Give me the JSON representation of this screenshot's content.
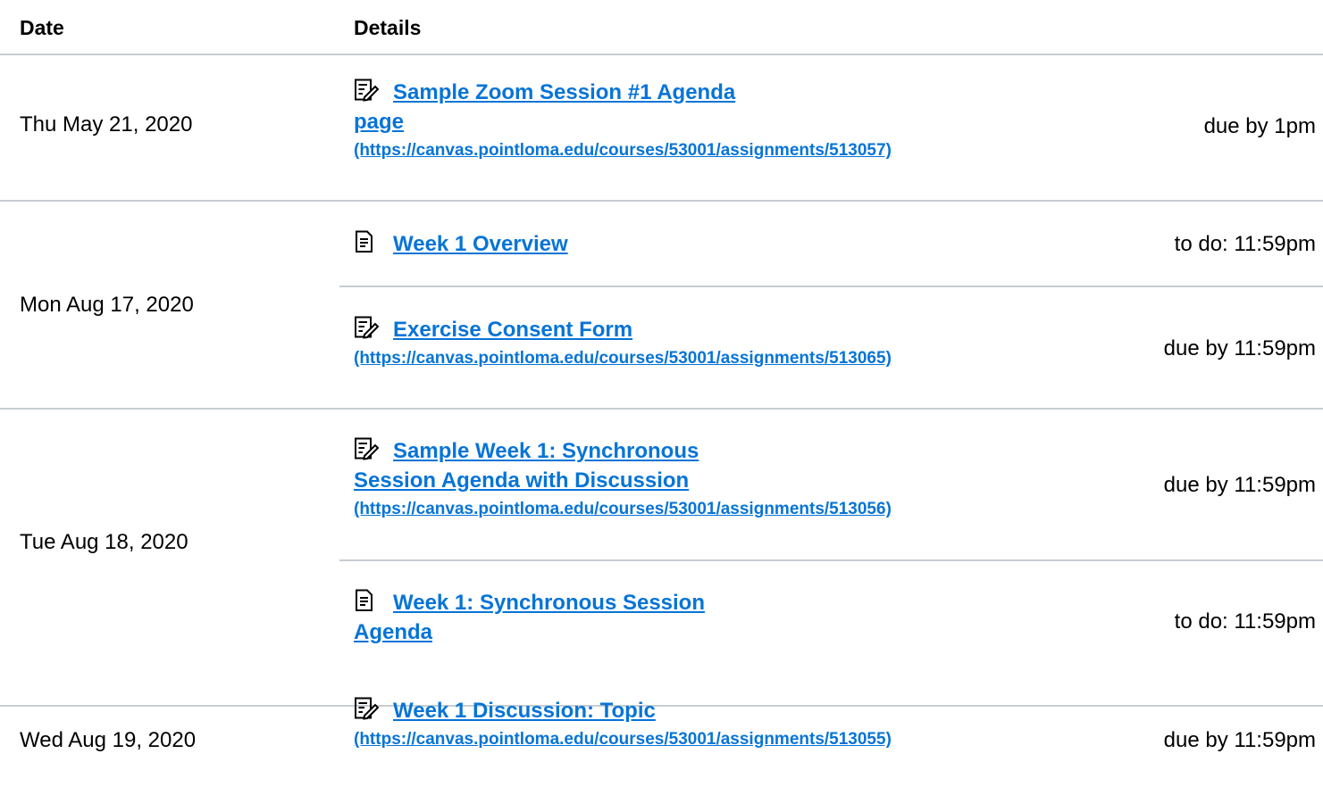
{
  "header": {
    "date_label": "Date",
    "details_label": "Details"
  },
  "groups": [
    {
      "date": "Thu May 21, 2020",
      "items": [
        {
          "icon": "assignment-icon",
          "title_line1": "Sample Zoom Session #1 Agenda",
          "title_line2": "page",
          "url": "(https://canvas.pointloma.edu/courses/53001/assignments/513057)",
          "due": "due by 1pm"
        }
      ]
    },
    {
      "date": "Mon Aug 17, 2020",
      "items": [
        {
          "icon": "page-icon",
          "title_line1": "Week 1 Overview",
          "due": "to do: 11:59pm"
        },
        {
          "icon": "assignment-icon",
          "title_line1": "Exercise Consent Form",
          "url": "(https://canvas.pointloma.edu/courses/53001/assignments/513065)",
          "due": "due by 11:59pm"
        }
      ]
    },
    {
      "date": "Tue Aug 18, 2020",
      "items": [
        {
          "icon": "assignment-icon",
          "title_line1": "Sample Week 1: Synchronous",
          "title_line2": "Session Agenda with Discussion",
          "url": "(https://canvas.pointloma.edu/courses/53001/assignments/513056)",
          "due": "due by 11:59pm"
        },
        {
          "icon": "page-icon",
          "title_line1": "Week 1: Synchronous Session",
          "title_line2": "Agenda",
          "due": "to do: 11:59pm"
        }
      ]
    },
    {
      "date": "Wed Aug 19, 2020",
      "items": [
        {
          "icon": "assignment-icon",
          "title_line1": "Week 1 Discussion: Topic",
          "url": "(https://canvas.pointloma.edu/courses/53001/assignments/513055)",
          "due": "due by 11:59pm"
        }
      ]
    }
  ],
  "colors": {
    "link": "#0774d7",
    "divider": "#c7cdd1",
    "text": "#000000"
  }
}
